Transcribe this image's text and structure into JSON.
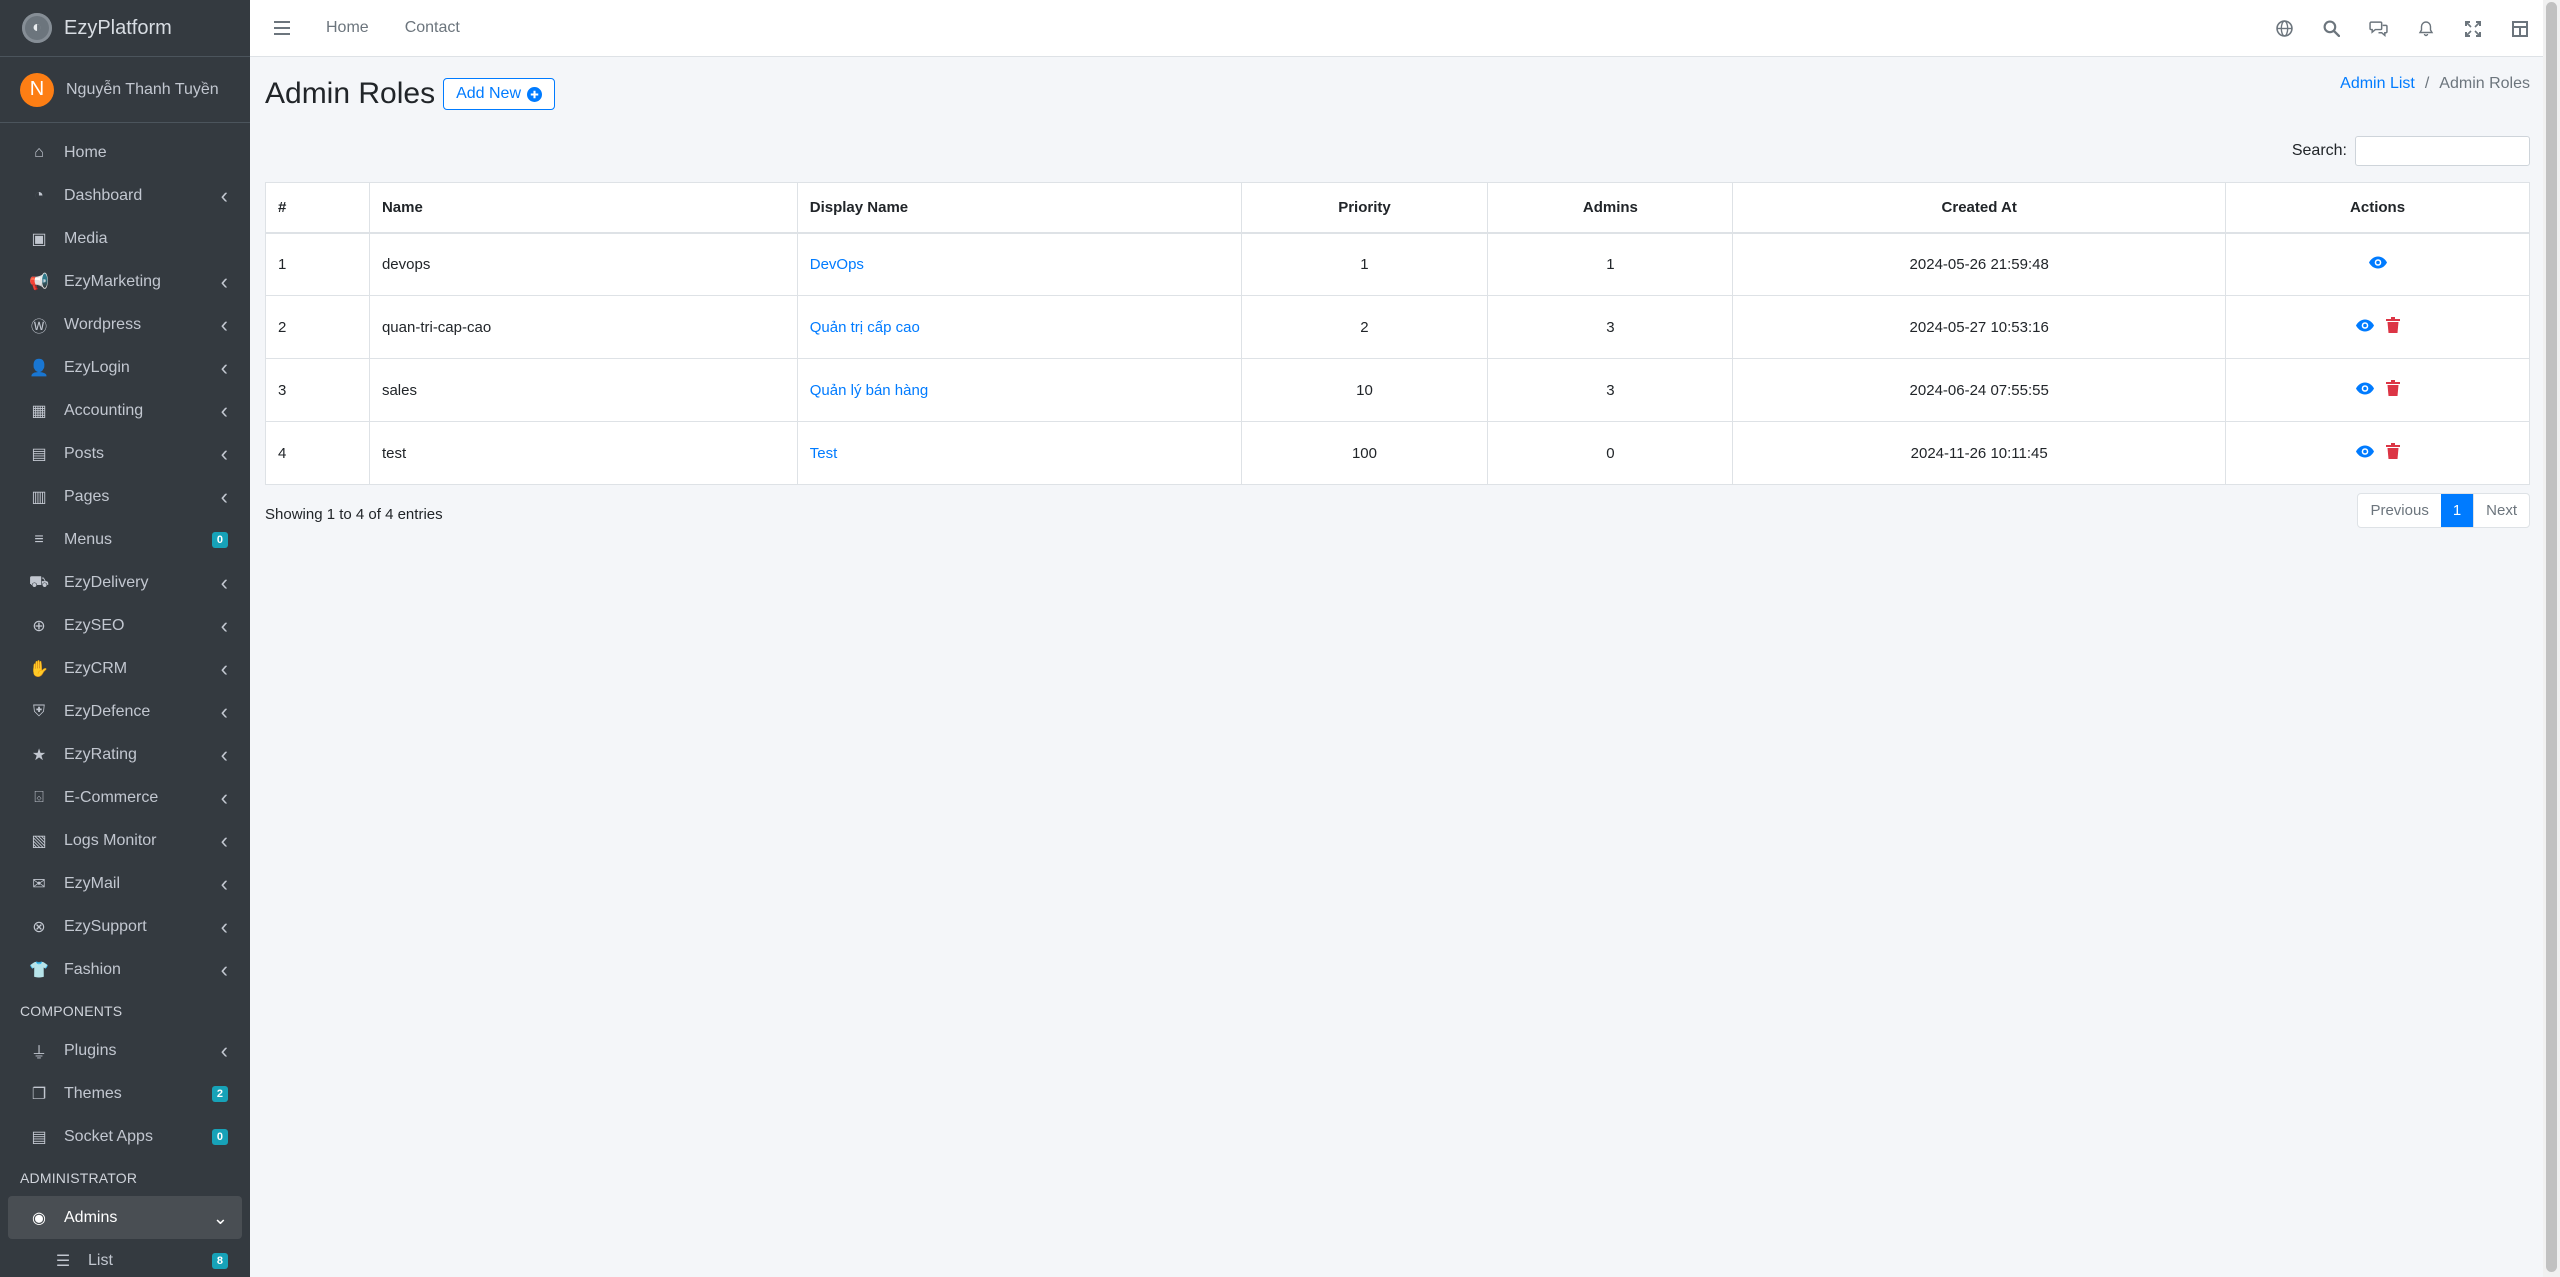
{
  "brand": {
    "name": "EzyPlatform"
  },
  "user": {
    "initial": "N",
    "name": "Nguyễn Thanh Tuyền"
  },
  "sidebar": {
    "items": [
      {
        "label": "Home",
        "icon": "home-icon",
        "chevron": false,
        "badge": ""
      },
      {
        "label": "Dashboard",
        "icon": "dashboard-icon",
        "chevron": true,
        "badge": ""
      },
      {
        "label": "Media",
        "icon": "image-icon",
        "chevron": false,
        "badge": ""
      },
      {
        "label": "EzyMarketing",
        "icon": "megaphone-icon",
        "chevron": true,
        "badge": ""
      },
      {
        "label": "Wordpress",
        "icon": "wordpress-icon",
        "chevron": true,
        "badge": ""
      },
      {
        "label": "EzyLogin",
        "icon": "user-lock-icon",
        "chevron": true,
        "badge": ""
      },
      {
        "label": "Accounting",
        "icon": "calculator-icon",
        "chevron": true,
        "badge": ""
      },
      {
        "label": "Posts",
        "icon": "newspaper-icon",
        "chevron": true,
        "badge": ""
      },
      {
        "label": "Pages",
        "icon": "columns-icon",
        "chevron": true,
        "badge": ""
      },
      {
        "label": "Menus",
        "icon": "bars-icon",
        "chevron": false,
        "badge": "0"
      },
      {
        "label": "EzyDelivery",
        "icon": "truck-icon",
        "chevron": true,
        "badge": ""
      },
      {
        "label": "EzySEO",
        "icon": "search-plus-icon",
        "chevron": true,
        "badge": ""
      },
      {
        "label": "EzyCRM",
        "icon": "handshake-icon",
        "chevron": true,
        "badge": ""
      },
      {
        "label": "EzyDefence",
        "icon": "shield-icon",
        "chevron": true,
        "badge": ""
      },
      {
        "label": "EzyRating",
        "icon": "star-icon",
        "chevron": true,
        "badge": ""
      },
      {
        "label": "E-Commerce",
        "icon": "shopping-basket-icon",
        "chevron": true,
        "badge": ""
      },
      {
        "label": "Logs Monitor",
        "icon": "file-medical-icon",
        "chevron": true,
        "badge": ""
      },
      {
        "label": "EzyMail",
        "icon": "envelope-icon",
        "chevron": true,
        "badge": ""
      },
      {
        "label": "EzySupport",
        "icon": "lifebuoy-icon",
        "chevron": true,
        "badge": ""
      },
      {
        "label": "Fashion",
        "icon": "tshirt-icon",
        "chevron": true,
        "badge": ""
      }
    ],
    "components_header": "COMPONENTS",
    "components": [
      {
        "label": "Plugins",
        "icon": "plug-icon",
        "chevron": true,
        "badge": ""
      },
      {
        "label": "Themes",
        "icon": "copy-icon",
        "chevron": false,
        "badge": "2"
      },
      {
        "label": "Socket Apps",
        "icon": "server-icon",
        "chevron": false,
        "badge": "0"
      }
    ],
    "admin_header": "ADMINISTRATOR",
    "admins": {
      "label": "Admins",
      "icon": "user-circle-icon"
    },
    "admins_sub": {
      "label": "List",
      "icon": "list-icon",
      "badge": "8"
    }
  },
  "topbar": {
    "home": "Home",
    "contact": "Contact"
  },
  "page": {
    "title": "Admin Roles",
    "add_new": "Add New",
    "breadcrumb_parent": "Admin List",
    "breadcrumb_sep": "/",
    "breadcrumb_current": "Admin Roles",
    "search_label": "Search:",
    "search_value": ""
  },
  "table": {
    "headers": [
      "#",
      "Name",
      "Display Name",
      "Priority",
      "Admins",
      "Created At",
      "Actions"
    ],
    "rows": [
      {
        "id": "1",
        "name": "devops",
        "display_name": "DevOps",
        "priority": "1",
        "admins": "1",
        "created_at": "2024-05-26 21:59:48",
        "deletable": false
      },
      {
        "id": "2",
        "name": "quan-tri-cap-cao",
        "display_name": "Quản trị cấp cao",
        "priority": "2",
        "admins": "3",
        "created_at": "2024-05-27 10:53:16",
        "deletable": true
      },
      {
        "id": "3",
        "name": "sales",
        "display_name": "Quản lý bán hàng",
        "priority": "10",
        "admins": "3",
        "created_at": "2024-06-24 07:55:55",
        "deletable": true
      },
      {
        "id": "4",
        "name": "test",
        "display_name": "Test",
        "priority": "100",
        "admins": "0",
        "created_at": "2024-11-26 10:11:45",
        "deletable": true
      }
    ]
  },
  "footer": {
    "info": "Showing 1 to 4 of 4 entries",
    "previous": "Previous",
    "page": "1",
    "next": "Next"
  },
  "colors": {
    "primary": "#007bff",
    "danger": "#dc3545",
    "sidebar": "#343a40",
    "badge": "#17a2b8"
  }
}
